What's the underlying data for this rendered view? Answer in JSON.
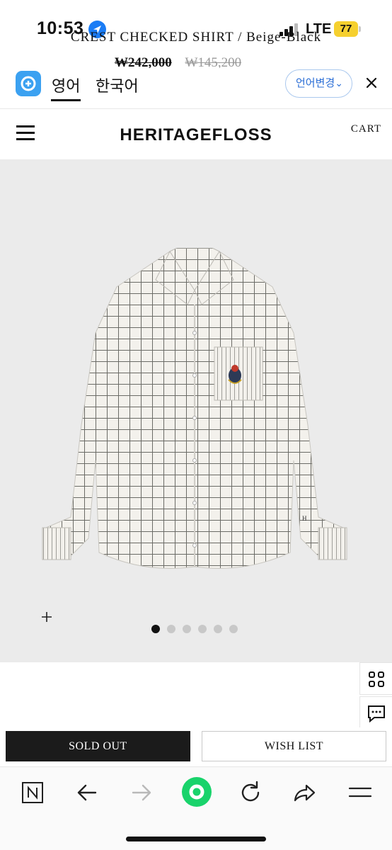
{
  "status_bar": {
    "time": "10:53",
    "carrier": "LTE",
    "battery": "77"
  },
  "translate_bar": {
    "tab_active": "영어",
    "tab_inactive": "한국어",
    "change_language": "언어변경"
  },
  "site": {
    "brand": "HERITAGEFLOSS",
    "cart": "CART"
  },
  "product": {
    "carousel_total": 6,
    "carousel_active_index": 0,
    "title": "CREST CHECKED SHIRT / Beige-Black",
    "price": "₩242,000",
    "price_original": "₩145,200"
  },
  "actions": {
    "sold_out": "SOLD OUT",
    "wish_list": "WISH LIST"
  },
  "colors": {
    "accent_blue": "#2c6fd6",
    "battery_yellow": "#f6d02f",
    "browser_green": "#19d36b",
    "sold_out_bg": "#1b1b1b"
  },
  "browser_toolbar": {
    "icons": [
      "naver-icon",
      "back-icon",
      "forward-icon",
      "green-dot-icon",
      "reload-icon",
      "share-icon",
      "menu-icon"
    ]
  }
}
